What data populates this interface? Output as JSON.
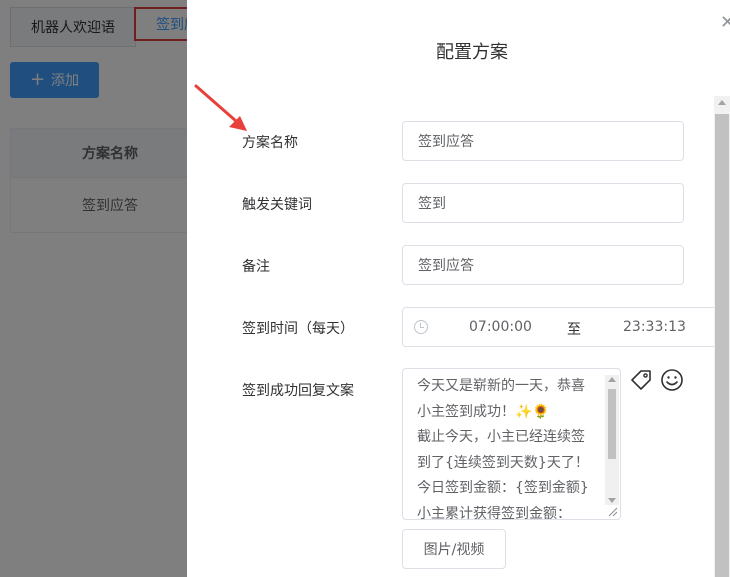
{
  "background": {
    "tabs": [
      {
        "label": "机器人欢迎语"
      },
      {
        "label": "签到应答"
      }
    ],
    "add_button": {
      "icon": "plus-icon",
      "label": "添加"
    },
    "table": {
      "header": "方案名称",
      "rows": [
        "签到应答"
      ]
    }
  },
  "drawer": {
    "title": "配置方案",
    "close_icon": "close-icon",
    "fields": {
      "name": {
        "label": "方案名称",
        "value": "签到应答"
      },
      "keyword": {
        "label": "触发关键词",
        "value": "签到"
      },
      "note": {
        "label": "备注",
        "value": "签到应答"
      },
      "time": {
        "label": "签到时间（每天）",
        "start": "07:00:00",
        "separator": "至",
        "end": "23:33:13"
      },
      "reply": {
        "label": "签到成功回复文案",
        "lines": [
          "今天又是崭新的一天，恭喜",
          "小主签到成功！✨🌻",
          "截止今天，小主已经连续签",
          "到了{连续签到天数}天了！",
          "今日签到金额：{签到金额}",
          "小主累计获得签到金额："
        ]
      }
    },
    "media_button": {
      "label": "图片/视频"
    },
    "icons": {
      "tag": "tag-icon",
      "emoji": "smile-icon",
      "clock": "clock-icon"
    }
  },
  "colors": {
    "primary": "#409eff",
    "highlight_border": "#e03c3c",
    "annotation_arrow": "#e8403a",
    "mask": "rgba(0,0,0,0.5)"
  }
}
